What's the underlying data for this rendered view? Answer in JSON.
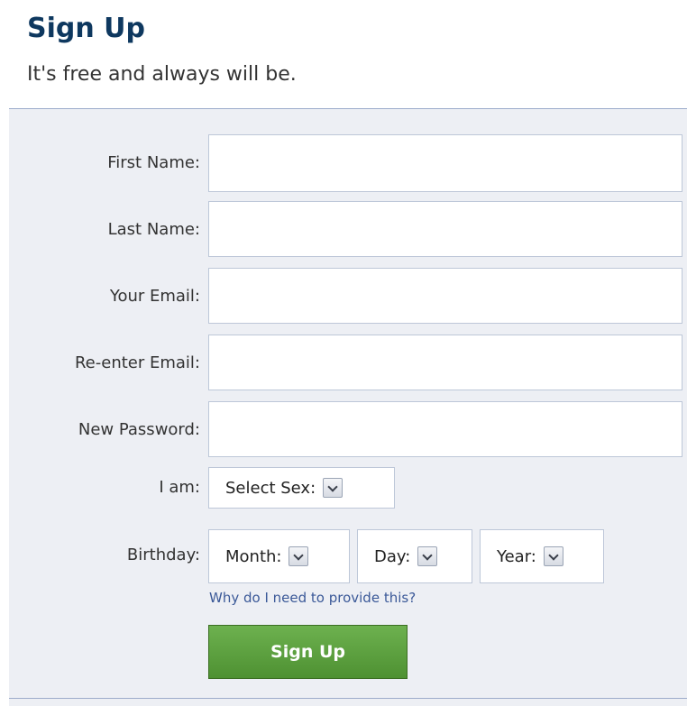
{
  "header": {
    "title": "Sign Up",
    "subtitle": "It's free and always will be."
  },
  "form": {
    "fields": [
      {
        "label": "First Name:",
        "value": ""
      },
      {
        "label": "Last Name:",
        "value": ""
      },
      {
        "label": "Your Email:",
        "value": ""
      },
      {
        "label": "Re-enter Email:",
        "value": ""
      },
      {
        "label": "New Password:",
        "value": ""
      }
    ],
    "sex": {
      "label": "I am:",
      "selected": "Select Sex:"
    },
    "birthday": {
      "label": "Birthday:",
      "month": "Month:",
      "day": "Day:",
      "year": "Year:"
    },
    "why_link": "Why do I need to provide this?",
    "submit_label": "Sign Up"
  },
  "colors": {
    "title": "#0e385f",
    "panel_bg": "#edeff4",
    "link": "#3b5998",
    "button": "#5ba43f"
  },
  "icons": {
    "dropdown": "chevron-down-icon"
  }
}
